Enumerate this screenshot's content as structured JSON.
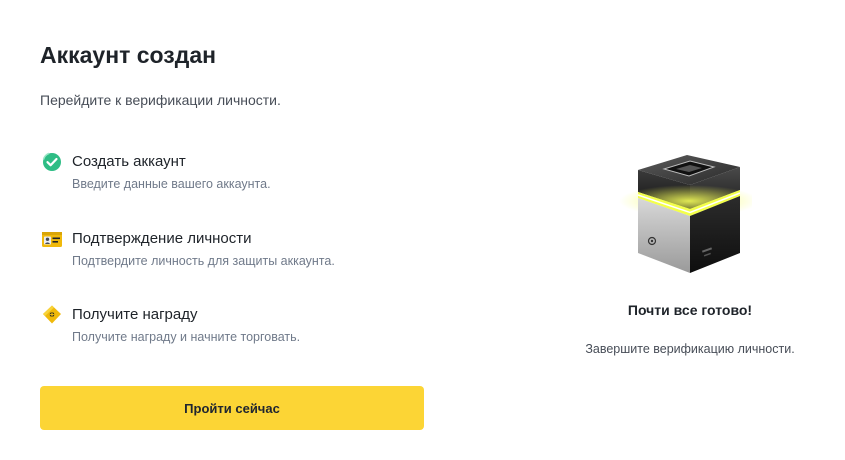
{
  "header": {
    "title": "Аккаунт создан",
    "subtitle": "Перейдите к верификации личности."
  },
  "steps": [
    {
      "icon": "check-circle-icon",
      "title": "Создать аккаунт",
      "description": "Введите данные вашего аккаунта."
    },
    {
      "icon": "id-card-icon",
      "title": "Подтверждение личности",
      "description": "Подтвердите личность для защиты аккаунта."
    },
    {
      "icon": "reward-tag-icon",
      "title": "Получите награду",
      "description": "Получите награду и начните торговать."
    }
  ],
  "cta": {
    "label": "Пройти сейчас"
  },
  "side_panel": {
    "illustration": "glowing-box-illustration",
    "title": "Почти все готово!",
    "description": "Завершите верификацию личности."
  },
  "colors": {
    "accent": "#fcd535",
    "success": "#2ebd85",
    "text_primary": "#1e2329",
    "text_secondary": "#707a8a"
  }
}
